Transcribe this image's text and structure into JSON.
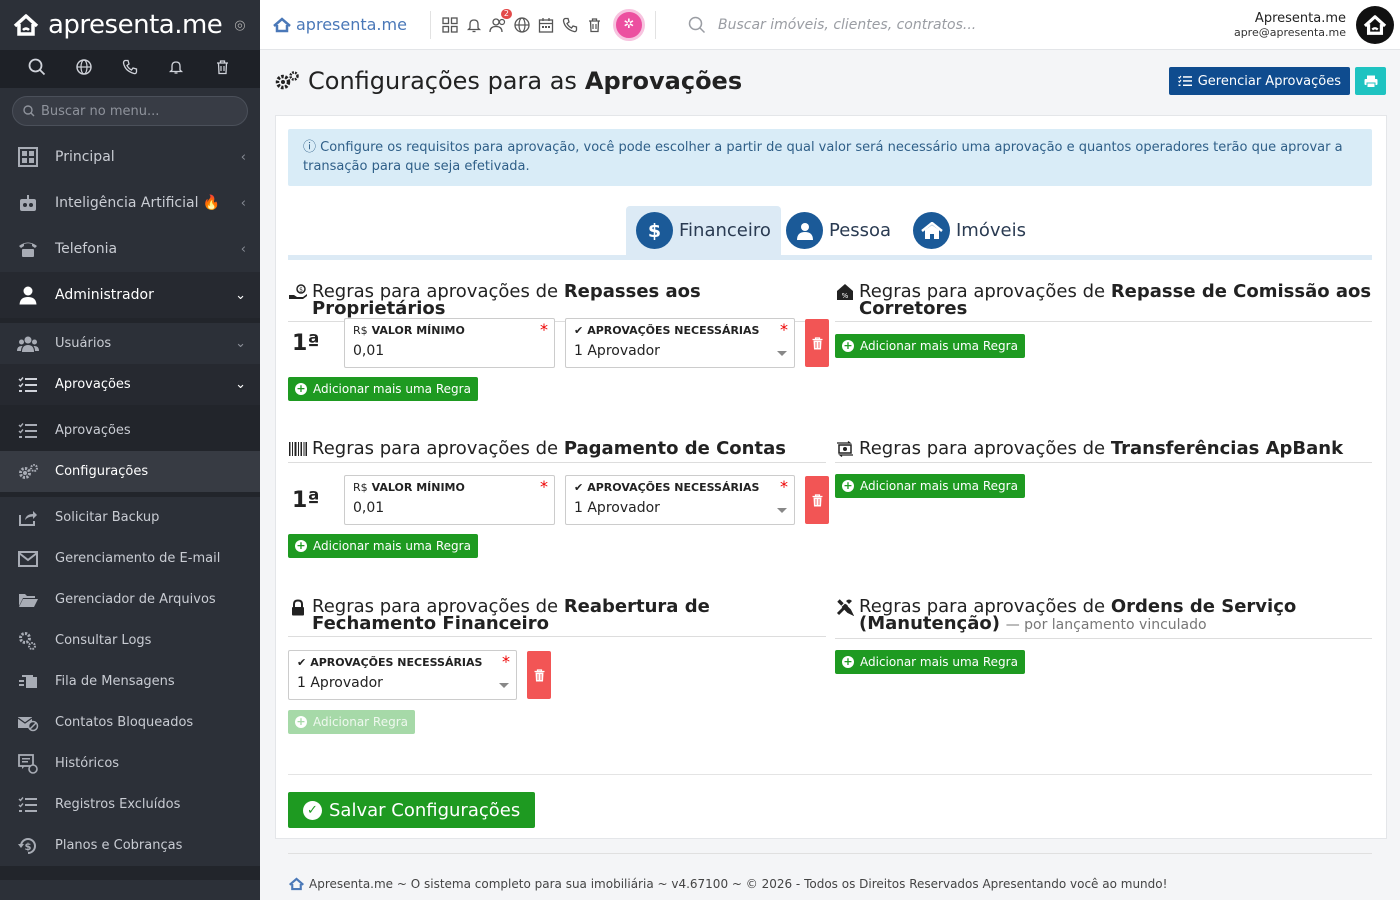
{
  "sidebar": {
    "brand": "apresenta.me",
    "search_placeholder": "Buscar no menu...",
    "items": [
      {
        "label": "Principal"
      },
      {
        "label": "Inteligência Artificial 🔥"
      },
      {
        "label": "Telefonia"
      },
      {
        "label": "Administrador"
      },
      {
        "label": "Usuários"
      },
      {
        "label": "Aprovações"
      },
      {
        "label": "Aprovações"
      },
      {
        "label": "Configurações"
      },
      {
        "label": "Solicitar Backup"
      },
      {
        "label": "Gerenciamento de E-mail"
      },
      {
        "label": "Gerenciador de Arquivos"
      },
      {
        "label": "Consultar Logs"
      },
      {
        "label": "Fila de Mensagens"
      },
      {
        "label": "Contatos Bloqueados"
      },
      {
        "label": "Históricos"
      },
      {
        "label": "Registros Excluídos"
      },
      {
        "label": "Planos e Cobranças"
      }
    ]
  },
  "topbar": {
    "logo": "apresenta.me",
    "notification_badge": "2",
    "search_placeholder": "Buscar imóveis, clientes, contratos...",
    "user_name": "Apresenta.me",
    "user_email": "apre@apresenta.me"
  },
  "page": {
    "title_prefix": "Configurações para as",
    "title_bold": "Aprovações",
    "manage_button": "Gerenciar Aprovações",
    "info": "Configure os requisitos para aprovação, você pode escolher a partir de qual valor será necessário uma aprovação e quantos operadores terão que aprovar a transação para que seja efetivada.",
    "tabs": [
      {
        "label": "Financeiro"
      },
      {
        "label": "Pessoa"
      },
      {
        "label": "Imóveis"
      }
    ],
    "rules_prefix": "Regras para aprovações de",
    "sections": {
      "repasses": {
        "bold": "Repasses aos Proprietários"
      },
      "comissao": {
        "bold": "Repasse de Comissão aos Corretores"
      },
      "pagamento": {
        "bold": "Pagamento de Contas"
      },
      "transferencias": {
        "bold": "Transferências ApBank"
      },
      "reabertura": {
        "bold": "Reabertura de Fechamento Financeiro"
      },
      "ordens": {
        "bold": "Ordens de Serviço (Manutenção)",
        "note": "— por lançamento vinculado"
      }
    },
    "rule_order": "1ª",
    "currency_prefix": "R$",
    "valor_minimo_label": "VALOR MÍNIMO",
    "aprovacoes_label": "APROVAÇÕES NECESSÁRIAS",
    "required_mark": "*",
    "valor_minimo_value": "0,01",
    "aprovador_value": "1 Aprovador",
    "add_rule_more": "Adicionar mais uma Regra",
    "add_rule": "Adicionar Regra",
    "save_button": "Salvar Configurações"
  },
  "footer": {
    "text": "Apresenta.me ~ O sistema completo para sua imobiliária ~ v4.67100 ~ © 2026 - Todos os Direitos Reservados Apresentando você ao mundo!"
  },
  "colors": {
    "sidebar_bg": "#2c3038",
    "primary_blue": "#0f4c8f",
    "tab_icon": "#1b5a98",
    "success_green": "#1e9a21",
    "danger_red": "#f25555",
    "info_bg": "#d9ecf7",
    "teal": "#1ec3c1"
  }
}
